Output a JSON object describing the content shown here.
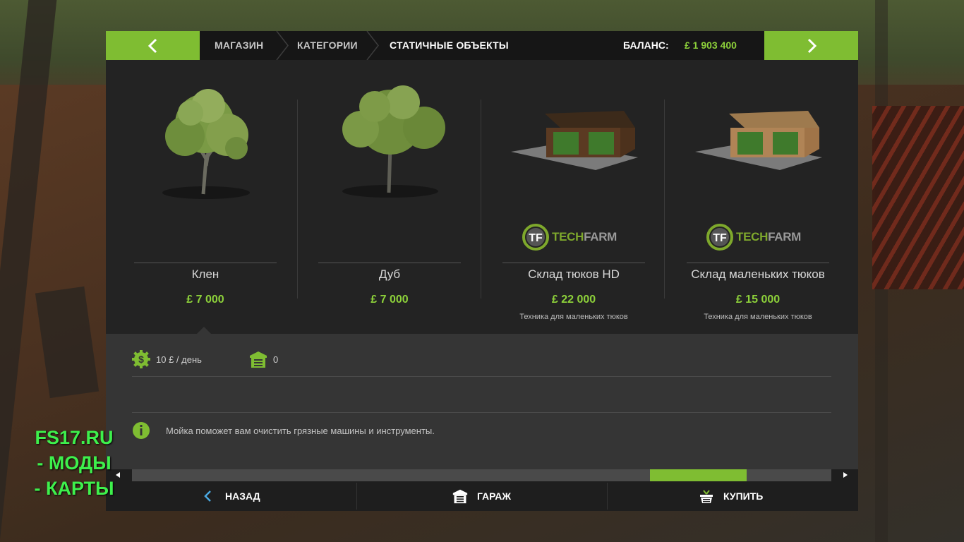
{
  "header": {
    "crumbs": [
      "МАГАЗИН",
      "КАТЕГОРИИ",
      "СТАТИЧНЫЕ ОБЪЕКТЫ"
    ],
    "balance_label": "БАЛАНС:",
    "balance_value": "£ 1 903 400"
  },
  "items": [
    {
      "name": "Клен",
      "price": "£ 7 000",
      "subtitle": "",
      "brand": ""
    },
    {
      "name": "Дуб",
      "price": "£ 7 000",
      "subtitle": "",
      "brand": ""
    },
    {
      "name": "Склад тюков HD",
      "price": "£ 22 000",
      "subtitle": "Техника для маленьких тюков",
      "brand": "TECHFARM"
    },
    {
      "name": "Склад маленьких тюков",
      "price": "£ 15 000",
      "subtitle": "Техника для маленьких тюков",
      "brand": "TECHFARM"
    }
  ],
  "brand_parts": {
    "tech": "TECH",
    "farm": "FARM"
  },
  "details": {
    "maintenance": "10 £ / день",
    "owned_count": "0",
    "info_text": "Мойка поможет вам очистить грязные машины и инструменты."
  },
  "bottom": {
    "back_label": "НАЗАД",
    "garage_label": "ГАРАЖ",
    "buy_label": "КУПИТЬ"
  },
  "watermark": {
    "line1": "FS17.RU",
    "line2": "- МОДЫ",
    "line3": "- КАРТЫ"
  },
  "colors": {
    "accent": "#7fbd32",
    "price": "#8dd13a"
  },
  "scroll": {
    "position": 0.86
  }
}
